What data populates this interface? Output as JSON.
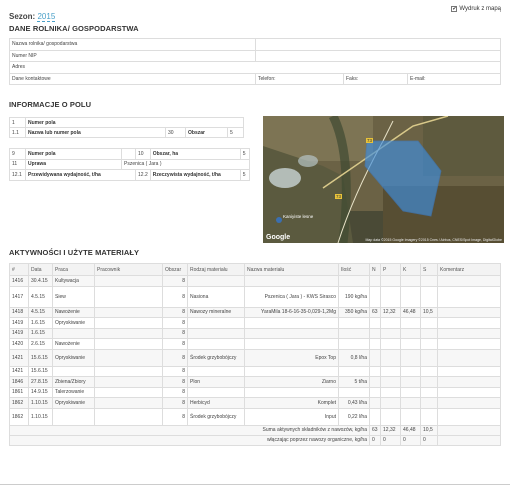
{
  "header": {
    "season_label": "Sezon:",
    "season_value": "2015",
    "print_label": "Wydruk z mapą",
    "print_checked": "✔"
  },
  "farmer": {
    "title": "DANE ROLNIKA/ GOSPODARSTWA",
    "name_label": "Nazwa rolnika/ gospodarstwa",
    "nip_label": "Numer NIP",
    "address_label": "Adres",
    "contact_label": "Dane kontaktowe",
    "phone_label": "Telefon:",
    "fax_label": "Faks:",
    "email_label": "E-mail:"
  },
  "field": {
    "title": "INFORMACJE O POLU",
    "r1": {
      "num": "1",
      "label": "Numer pola"
    },
    "r2": {
      "num": "1.1",
      "label": "Nazwa lub numer pola",
      "num2": "30",
      "label2": "Obszar",
      "val2": "5"
    },
    "r3": {
      "num": "9",
      "label": "Numer pola",
      "num2": "10",
      "label2": "Obszar, ha",
      "val2": "5"
    },
    "r4": {
      "num": "11",
      "label": "Uprawa",
      "value": "Pszenica ( Jara )"
    },
    "r5": {
      "num": "12.1",
      "label": "Przewidywana wydajność, t/ha",
      "num2": "12.2",
      "label2": "Rzeczywista wydajność, t/ha",
      "val2": "5"
    }
  },
  "map": {
    "place": "Kaniyiste lesne",
    "road1": "73",
    "road2": "73",
    "google": "Google",
    "attribution": "Map data ©2015 Google  Imagery ©2015 Cnes / Airbus, CNES/Spot Image, DigitalGlobe"
  },
  "activities": {
    "title": "AKTYWNOŚCI I UŻYTE MATERIAŁY",
    "headers": [
      "#",
      "Data",
      "Praca",
      "Pracownik",
      "Obszar",
      "Rodzaj materiału",
      "Nazwa materiału",
      "Ilość",
      "N",
      "P",
      "K",
      "S",
      "Komentarz"
    ],
    "rows": [
      {
        "id": "1416",
        "date": "30.4.15",
        "work": "Kultywacja",
        "area": "8",
        "type": "",
        "name": "",
        "qty": "",
        "n": "",
        "p": "",
        "k": "",
        "s": ""
      },
      {
        "id": "1417",
        "date": "4.5.15",
        "work": "Siew",
        "area": "8",
        "type": "Nasiona",
        "name": "Pszenica ( Jara ) - KWS Sirasco",
        "qty": "190 kg/ha",
        "n": "",
        "p": "",
        "k": "",
        "s": ""
      },
      {
        "id": "1418",
        "date": "4.5.15",
        "work": "Nawożenie",
        "area": "8",
        "type": "Nawozy mineralne",
        "name": "YaraMila 18-6-16-35-0,029-1,2Mg",
        "qty": "350 kg/ha",
        "n": "63",
        "p": "12,32",
        "k": "46,48",
        "s": "10,5"
      },
      {
        "id": "1419",
        "date": "1.6.15",
        "work": "Opryskiwanie",
        "area": "8",
        "type": "",
        "name": "",
        "qty": "",
        "n": "",
        "p": "",
        "k": "",
        "s": ""
      },
      {
        "id": "1419",
        "date": "1.6.15",
        "work": "",
        "area": "8",
        "type": "",
        "name": "",
        "qty": "",
        "n": "",
        "p": "",
        "k": "",
        "s": ""
      },
      {
        "id": "1420",
        "date": "2.6.15",
        "work": "Nawożenie",
        "area": "8",
        "type": "",
        "name": "",
        "qty": "",
        "n": "",
        "p": "",
        "k": "",
        "s": ""
      },
      {
        "id": "1421",
        "date": "15.6.15",
        "work": "Opryskiwanie",
        "area": "8",
        "type": "Środek grzybobójczy",
        "name": "Epox Top",
        "qty": "0,8 l/ha",
        "n": "",
        "p": "",
        "k": "",
        "s": ""
      },
      {
        "id": "1421",
        "date": "15.6.15",
        "work": "",
        "area": "8",
        "type": "",
        "name": "",
        "qty": "",
        "n": "",
        "p": "",
        "k": "",
        "s": ""
      },
      {
        "id": "1846",
        "date": "27.8.15",
        "work": "Zbiena/Zbiory",
        "area": "8",
        "type": "Plon",
        "name": "Ziarno",
        "qty": "5 t/ha",
        "n": "",
        "p": "",
        "k": "",
        "s": ""
      },
      {
        "id": "1861",
        "date": "14.9.15",
        "work": "Talerzowanie",
        "area": "8",
        "type": "",
        "name": "",
        "qty": "",
        "n": "",
        "p": "",
        "k": "",
        "s": ""
      },
      {
        "id": "1862",
        "date": "1.10.15",
        "work": "Opryskiwanie",
        "area": "8",
        "type": "Herbicyd",
        "name": "Komplet",
        "qty": "0,43 l/ha",
        "n": "",
        "p": "",
        "k": "",
        "s": ""
      },
      {
        "id": "1862",
        "date": "1.10.15",
        "work": "",
        "area": "8",
        "type": "Środek grzybobójczy",
        "name": "Input",
        "qty": "0,22 l/ha",
        "n": "",
        "p": "",
        "k": "",
        "s": ""
      }
    ],
    "sum1_label": "Suma aktywnych składników z nawozów, kg/ha",
    "sum1": {
      "n": "63",
      "p": "12,32",
      "k": "46,48",
      "s": "10,5"
    },
    "sum2_label": "włączając poprzez nawozy organiczne, kg/ha",
    "sum2": {
      "n": "0",
      "p": "0",
      "k": "0",
      "s": "0"
    }
  }
}
